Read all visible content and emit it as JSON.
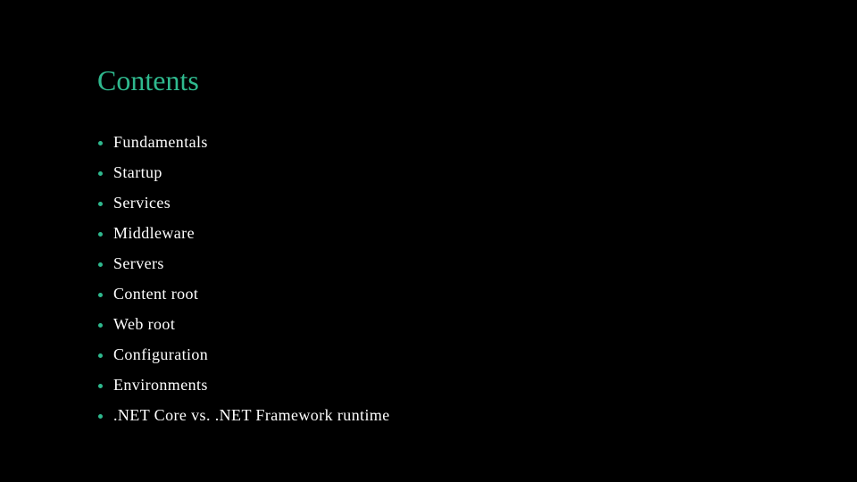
{
  "slide": {
    "title": "Contents",
    "accent_color": "#2fb98e",
    "items": [
      {
        "label": "Fundamentals"
      },
      {
        "label": "Startup"
      },
      {
        "label": "Services"
      },
      {
        "label": "Middleware"
      },
      {
        "label": "Servers"
      },
      {
        "label": "Content root"
      },
      {
        "label": "Web root"
      },
      {
        "label": "Configuration"
      },
      {
        "label": "Environments"
      },
      {
        "label": ".NET Core vs. .NET Framework runtime"
      }
    ]
  }
}
